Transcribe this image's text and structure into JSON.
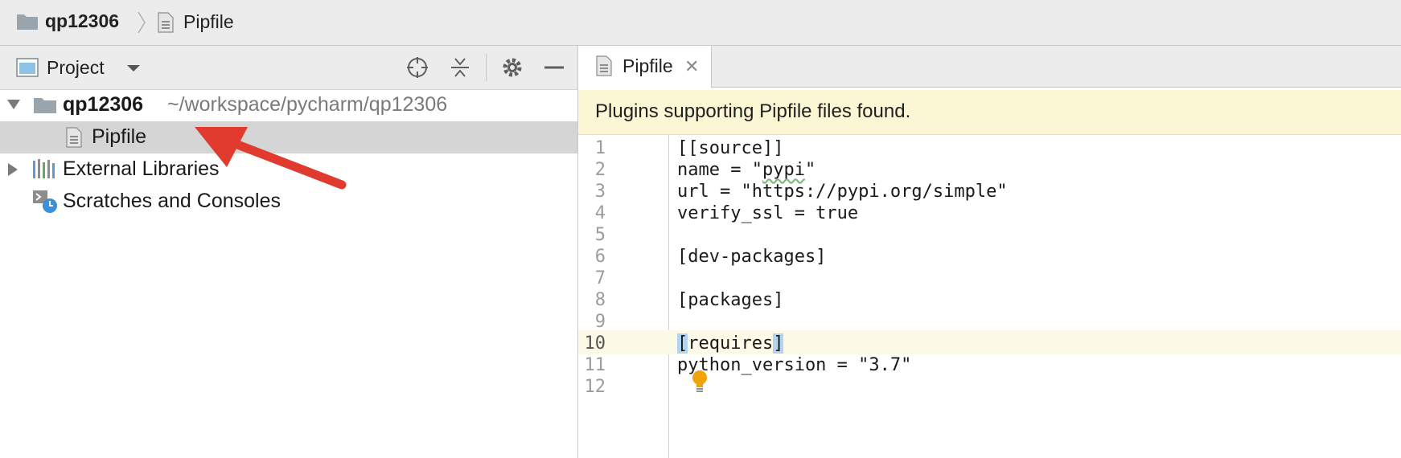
{
  "navbar": {
    "project": "qp12306",
    "file": "Pipfile"
  },
  "project_panel": {
    "title": "Project",
    "tree": [
      {
        "label": "qp12306",
        "path": "~/workspace/pycharm/qp12306",
        "expanded": true,
        "icon": "folder-icon"
      },
      {
        "label": "Pipfile",
        "selected": true,
        "icon": "file-icon"
      },
      {
        "label": "External Libraries",
        "expanded": false,
        "icon": "library-icon"
      },
      {
        "label": "Scratches and Consoles",
        "icon": "scratches-icon"
      }
    ]
  },
  "editor": {
    "tab_label": "Pipfile",
    "notice": "Plugins supporting Pipfile files found.",
    "lines": [
      {
        "n": "1",
        "text": "[[source]]"
      },
      {
        "n": "2",
        "pre": "name = \"",
        "word": "pypi",
        "post": "\""
      },
      {
        "n": "3",
        "text": "url = \"https://pypi.org/simple\""
      },
      {
        "n": "4",
        "text": "verify_ssl = true"
      },
      {
        "n": "5",
        "text": ""
      },
      {
        "n": "6",
        "text": "[dev-packages]"
      },
      {
        "n": "7",
        "text": ""
      },
      {
        "n": "8",
        "text": "[packages]"
      },
      {
        "n": "9",
        "text": ""
      },
      {
        "n": "10",
        "open": "[",
        "mid": "requires",
        "close": "]",
        "current": true
      },
      {
        "n": "11",
        "text": "python_version = \"3.7\""
      },
      {
        "n": "12",
        "text": ""
      }
    ]
  },
  "colors": {
    "selection": "#d5d5d5",
    "notice_bg": "#fbf6d4",
    "arrow": "#e03b2e",
    "bulb": "#f0a30a"
  }
}
